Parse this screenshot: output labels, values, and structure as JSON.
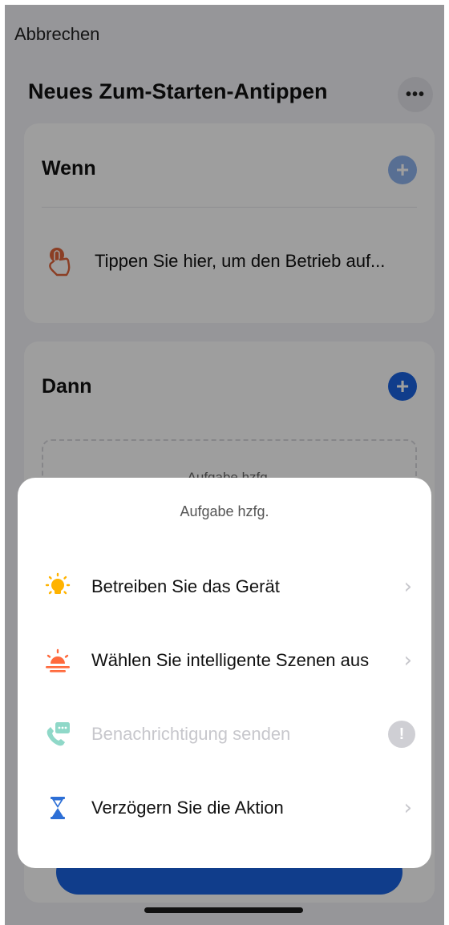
{
  "header": {
    "cancel_label": "Abbrechen",
    "title": "Neues Zum-Starten-Antippen",
    "more_label": "•••"
  },
  "wenn": {
    "heading": "Wenn",
    "add_label": "+",
    "trigger_text": "Tippen Sie hier, um den Betrieb auf...",
    "trigger_icon": "tap-hand-icon"
  },
  "dann": {
    "heading": "Dann",
    "add_label": "+",
    "placeholder": "Aufgabe hzfg."
  },
  "sheet": {
    "title": "Aufgabe hzfg.",
    "items": [
      {
        "label": "Betreiben Sie das Gerät",
        "icon": "bulb-icon",
        "enabled": true,
        "trailing": "›"
      },
      {
        "label": "Wählen Sie intelligente Szenen aus",
        "icon": "sunrise-icon",
        "enabled": true,
        "trailing": "›"
      },
      {
        "label": "Benachrichtigung senden",
        "icon": "phone-message-icon",
        "enabled": false,
        "trailing": "!"
      },
      {
        "label": "Verzögern Sie die Aktion",
        "icon": "hourglass-icon",
        "enabled": true,
        "trailing": "›"
      }
    ]
  },
  "colors": {
    "accent_blue": "#1a63e0",
    "bulb_orange": "#ffb300",
    "sunrise_orange": "#ff6a3d",
    "phone_teal": "#8fd8c8",
    "hourglass_blue": "#2d6fd6",
    "hand_orange": "#e0643a"
  }
}
